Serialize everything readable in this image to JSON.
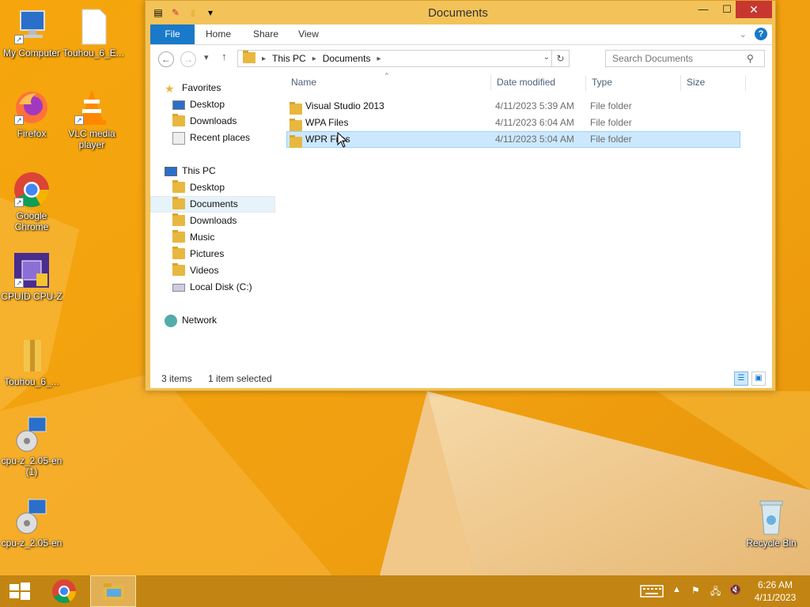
{
  "desktop": {
    "icons": [
      {
        "label": "My Computer"
      },
      {
        "label": "Touhou_6_E..."
      },
      {
        "label": "Firefox"
      },
      {
        "label": "VLC media player"
      },
      {
        "label": "Google Chrome"
      },
      {
        "label": "CPUID CPU-Z"
      },
      {
        "label": "Touhou_6_..."
      },
      {
        "label": "cpu-z_2.05-en (1)"
      },
      {
        "label": "cpu-z_2.05-en"
      },
      {
        "label": "Recycle Bin"
      }
    ]
  },
  "window": {
    "title": "Documents",
    "qat_icons": [
      "properties-icon",
      "new-folder-icon",
      "folder-icon",
      "dropdown-icon"
    ],
    "controls": {
      "minimize": "—",
      "maximize": "☐",
      "close": "✕"
    },
    "ribbon_tabs": [
      "File",
      "Home",
      "Share",
      "View"
    ],
    "nav": {
      "back": "←",
      "forward": "→",
      "recent": "▾",
      "up": "↑",
      "breadcrumb": [
        "This PC",
        "Documents"
      ],
      "search_placeholder": "Search Documents"
    },
    "navpane": {
      "favorites_label": "Favorites",
      "favorites": [
        "Desktop",
        "Downloads",
        "Recent places"
      ],
      "thispc_label": "This PC",
      "thispc": [
        "Desktop",
        "Documents",
        "Downloads",
        "Music",
        "Pictures",
        "Videos",
        "Local Disk (C:)"
      ],
      "network_label": "Network"
    },
    "columns": [
      "Name",
      "Date modified",
      "Type",
      "Size"
    ],
    "files": [
      {
        "name": "Visual Studio 2013",
        "date": "4/11/2023 5:39 AM",
        "type": "File folder",
        "selected": false
      },
      {
        "name": "WPA Files",
        "date": "4/11/2023 6:04 AM",
        "type": "File folder",
        "selected": false
      },
      {
        "name": "WPR Files",
        "date": "4/11/2023 5:04 AM",
        "type": "File folder",
        "selected": true
      }
    ],
    "status": {
      "count": "3 items",
      "selection": "1 item selected"
    }
  },
  "taskbar": {
    "apps": [
      "start-button",
      "chrome",
      "file-explorer"
    ],
    "clock_time": "6:26 AM",
    "clock_date": "4/11/2023"
  },
  "colors": {
    "accent": "#1979ca",
    "wallpaper": "#f0a010",
    "selection": "#cce8ff"
  }
}
